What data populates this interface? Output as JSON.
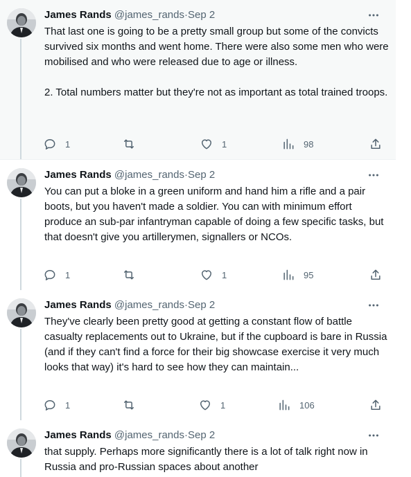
{
  "tweets": [
    {
      "name": "James Rands",
      "handle": "@james_rands",
      "dot": "·",
      "date": "Sep 2",
      "text": "That last one is going to be a pretty small group but some of the convicts survived six months and went home. There were also some men who were mobilised and who were released due to age or illness.\n\n2. Total numbers matter but they're not as important as total trained troops.",
      "replies": "1",
      "retweets": "",
      "likes": "1",
      "views": "98"
    },
    {
      "name": "James Rands",
      "handle": "@james_rands",
      "dot": "·",
      "date": "Sep 2",
      "text": "You can put a bloke in a green uniform and hand him a rifle and a pair boots, but you haven't made a soldier. You can with minimum effort produce an sub-par infantryman capable of doing a few specific tasks, but that doesn't give you artillerymen, signallers or NCOs.",
      "replies": "1",
      "retweets": "",
      "likes": "1",
      "views": "95"
    },
    {
      "name": "James Rands",
      "handle": "@james_rands",
      "dot": "·",
      "date": "Sep 2",
      "text": "They've clearly been pretty good at getting a constant flow of battle casualty replacements out to Ukraine, but if the cupboard is bare in Russia (and if they can't find a force for their big showcase exercise it very much looks that way) it's hard to see how they can maintain...",
      "replies": "1",
      "retweets": "",
      "likes": "1",
      "views": "106"
    },
    {
      "name": "James Rands",
      "handle": "@james_rands",
      "dot": "·",
      "date": "Sep 2",
      "text": "that supply. Perhaps more significantly there is a lot of talk right now in Russia and pro-Russian spaces about another"
    }
  ],
  "icons": {
    "more": "more-horizontal-icon",
    "reply": "reply-icon",
    "retweet": "retweet-icon",
    "like": "heart-icon",
    "views": "views-icon",
    "share": "share-icon"
  },
  "colors": {
    "highlight_bg": "#f7f9f9",
    "muted": "#536471",
    "thread_line": "#cfd9de",
    "text": "#0f1419"
  }
}
